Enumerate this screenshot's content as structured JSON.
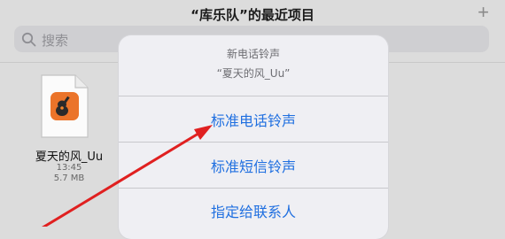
{
  "header": {
    "title": "“库乐队”的最近项目",
    "add_label": "+"
  },
  "search": {
    "placeholder": "搜索"
  },
  "file": {
    "name": "夏天的风_Uu",
    "time": "13:45",
    "size": "5.7 MB"
  },
  "sheet": {
    "title": "新电话铃声",
    "subtitle": "“夏天的风_Uu”",
    "options": [
      "标准电话铃声",
      "标准短信铃声",
      "指定给联系人"
    ]
  },
  "colors": {
    "accent": "#1f6fe0",
    "annotation": "#e02020",
    "app_icon": "#f0842a"
  }
}
